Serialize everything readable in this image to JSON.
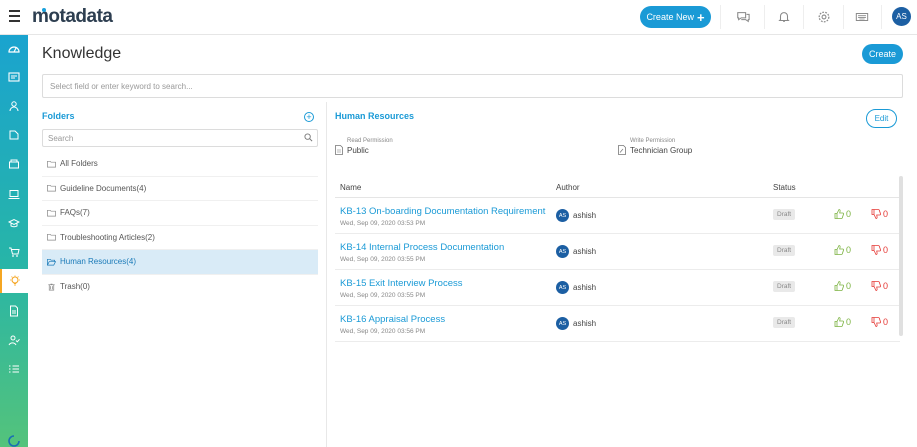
{
  "header": {
    "logo_text": "motadata",
    "create_new_label": "Create New",
    "user_initials": "AS"
  },
  "icons": {
    "menu": "hamburger-icon",
    "chat": "chat-icon",
    "notifications": "bell-icon",
    "settings": "gear-icon",
    "keyboard": "keyboard-icon"
  },
  "nav": [
    "dashboard-icon",
    "request-icon",
    "users-icon",
    "problem-icon",
    "asset-icon",
    "laptop-icon",
    "education-icon",
    "cart-icon",
    "knowledge-icon",
    "contract-icon",
    "user-check-icon",
    "task-list-icon"
  ],
  "page": {
    "title": "Knowledge",
    "create_label": "Create",
    "search_placeholder": "Select field or enter keyword to search..."
  },
  "folders": {
    "title": "Folders",
    "search_placeholder": "Search",
    "items": [
      {
        "label": "All Folders"
      },
      {
        "label": "Guideline Documents(4)"
      },
      {
        "label": "FAQs(7)"
      },
      {
        "label": "Troubleshooting Articles(2)"
      },
      {
        "label": "Human Resources(4)"
      },
      {
        "label": "Trash(0)"
      }
    ],
    "active_index": 4
  },
  "details": {
    "heading": "Human Resources",
    "edit_label": "Edit",
    "read_permission": {
      "label": "Read Permission",
      "value": "Public"
    },
    "write_permission": {
      "label": "Write Permission",
      "value": "Technician Group"
    },
    "columns": {
      "name": "Name",
      "author": "Author",
      "status": "Status"
    },
    "rows": [
      {
        "title": "KB-13 On-boarding Documentation Requirement",
        "date": "Wed, Sep 09, 2020 03:53 PM",
        "author_initials": "AS",
        "author": "ashish",
        "status": "Draft",
        "likes": "0",
        "dislikes": "0"
      },
      {
        "title": "KB-14 Internal Process Documentation",
        "date": "Wed, Sep 09, 2020 03:55 PM",
        "author_initials": "AS",
        "author": "ashish",
        "status": "Draft",
        "likes": "0",
        "dislikes": "0"
      },
      {
        "title": "KB-15 Exit Interview Process",
        "date": "Wed, Sep 09, 2020 03:55 PM",
        "author_initials": "AS",
        "author": "ashish",
        "status": "Draft",
        "likes": "0",
        "dislikes": "0"
      },
      {
        "title": "KB-16 Appraisal Process",
        "date": "Wed, Sep 09, 2020 03:56 PM",
        "author_initials": "AS",
        "author": "ashish",
        "status": "Draft",
        "likes": "0",
        "dislikes": "0"
      }
    ]
  }
}
